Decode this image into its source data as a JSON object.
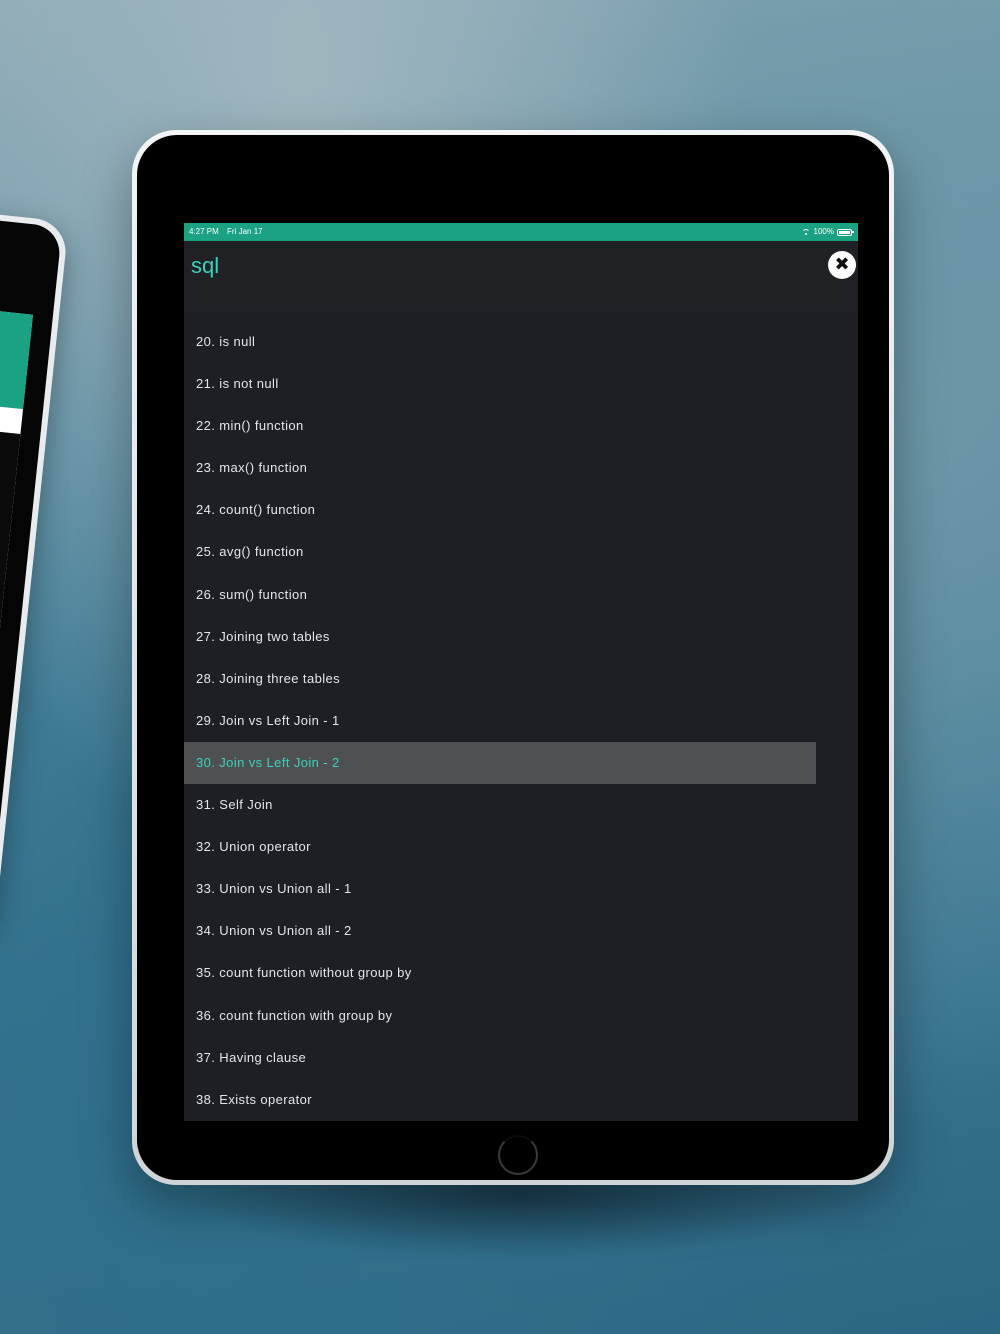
{
  "status_bar": {
    "time": "4:27 PM",
    "date": "Fri Jan 17",
    "battery": "100%"
  },
  "header": {
    "title": "sql",
    "close_icon": "close-icon"
  },
  "colors": {
    "accent": "#1aa283",
    "title_accent": "#3ad1bf",
    "background": "#1e1f24",
    "active_row": "#4f5052"
  },
  "topics": [
    "20. is null",
    "21. is not null",
    "22. min() function",
    "23. max() function",
    "24. count() function",
    "25. avg() function",
    "26. sum() function",
    "27. Joining two tables",
    "28. Joining three tables",
    "29. Join vs Left Join - 1",
    "30. Join vs Left Join - 2",
    "31. Self Join",
    "32. Union operator",
    "33. Union vs Union all - 1",
    "34. Union vs Union all - 2",
    "35. count function without group by",
    "36. count function with group by",
    "37. Having clause",
    "38. Exists operator"
  ],
  "active_index": 10
}
